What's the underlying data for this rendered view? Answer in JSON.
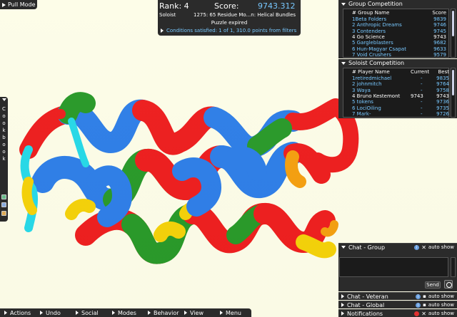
{
  "pull_mode": {
    "label": "Pull Mode"
  },
  "score_panel": {
    "rank": "Rank: 4",
    "score_label": "Score:",
    "score_value": "9743.312",
    "mode": "Soloist",
    "puzzle": "1275: 65 Residue Mo...n: Helical Bundles",
    "status": "Puzzle expired",
    "conditions": "Conditions satisfied: 1 of 1, 310.0 points from filters"
  },
  "cookbook": {
    "letters": [
      "C",
      "o",
      "o",
      "k",
      "b",
      "o",
      "o",
      "k"
    ]
  },
  "group_competition": {
    "title": "Group Competition",
    "headers": {
      "name": "# Group Name",
      "score": "Score"
    },
    "rows": [
      {
        "name": "1Beta Folders",
        "score": "9839",
        "highlight": false
      },
      {
        "name": "2 Anthropic Dreams",
        "score": "9746",
        "highlight": false
      },
      {
        "name": "3 Contenders",
        "score": "9745",
        "highlight": false
      },
      {
        "name": "4 Go Science",
        "score": "9743",
        "highlight": true
      },
      {
        "name": "5 Gargleblasters",
        "score": "9682",
        "highlight": false
      },
      {
        "name": "6 Hun-Magyar Csapat",
        "score": "9633",
        "highlight": false
      },
      {
        "name": "7 Void Crushers",
        "score": "9579",
        "highlight": false
      }
    ]
  },
  "soloist_competition": {
    "title": "Soloist Competition",
    "headers": {
      "name": "# Player Name",
      "current": "Current",
      "best": "Best"
    },
    "rows": [
      {
        "name": "1retiredmichael",
        "current": "-",
        "best": "9835",
        "highlight": false
      },
      {
        "name": "2 johnmitch",
        "current": "-",
        "best": "9764",
        "highlight": false
      },
      {
        "name": "3 Waya",
        "current": "-",
        "best": "9758",
        "highlight": false
      },
      {
        "name": "4 Bruno Kestemont",
        "current": "9743",
        "best": "9743",
        "highlight": true
      },
      {
        "name": "5 tokens",
        "current": "-",
        "best": "9736",
        "highlight": false
      },
      {
        "name": "6 LociOiling",
        "current": "-",
        "best": "9735",
        "highlight": false
      },
      {
        "name": "7 Mark-",
        "current": "-",
        "best": "9726",
        "highlight": false
      }
    ]
  },
  "chat": {
    "group": "Chat - Group",
    "send": "Send",
    "veteran": "Chat - Veteran",
    "global": "Chat - Global",
    "notifications": "Notifications",
    "auto_show": "auto show"
  },
  "bottom_menu": {
    "items": [
      "Actions",
      "Undo",
      "Social",
      "Modes",
      "Behavior",
      "View",
      "Menu"
    ]
  },
  "colors": {
    "helix": "#ee1f1f",
    "sheet": "#2f7fe8",
    "loop_green": "#2a9a2a",
    "yellow": "#f5d20a",
    "orange": "#f5a010",
    "cyan": "#27d9e8"
  }
}
